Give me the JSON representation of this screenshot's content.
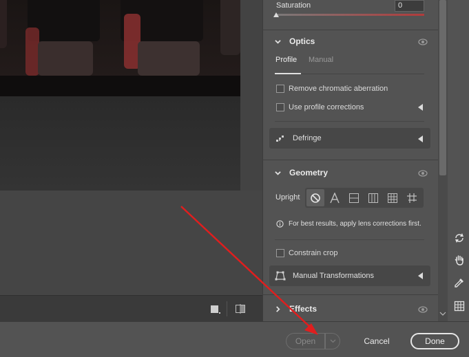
{
  "saturation": {
    "label": "Saturation",
    "value": "0",
    "slider_level": 0
  },
  "optics": {
    "title": "Optics",
    "tabs": [
      {
        "label": "Profile",
        "active": true
      },
      {
        "label": "Manual",
        "active": false
      }
    ],
    "remove_ca_label": "Remove chromatic aberration",
    "remove_ca_checked": false,
    "profile_corrections_label": "Use profile corrections",
    "profile_corrections_checked": false,
    "defringe_label": "Defringe"
  },
  "geometry": {
    "title": "Geometry",
    "upright_label": "Upright",
    "upright_options": [
      "off-icon",
      "auto-icon",
      "level-icon",
      "vertical-icon",
      "full-icon",
      "guided-icon"
    ],
    "upright_selected": "off-icon",
    "info_text": "For best results, apply lens corrections first.",
    "constrain_crop_label": "Constrain crop",
    "constrain_crop_checked": false,
    "manual_transformations_label": "Manual Transformations"
  },
  "effects": {
    "title": "Effects"
  },
  "footer": {
    "open_label": "Open",
    "cancel_label": "Cancel",
    "done_label": "Done"
  },
  "colors": {
    "annotation_arrow": "#e01e1e",
    "panel_bg": "#535353",
    "canvas_bg": "#434343"
  },
  "right_tools": [
    "rotate-icon",
    "hand-icon",
    "eyedropper-icon",
    "grid-icon"
  ]
}
